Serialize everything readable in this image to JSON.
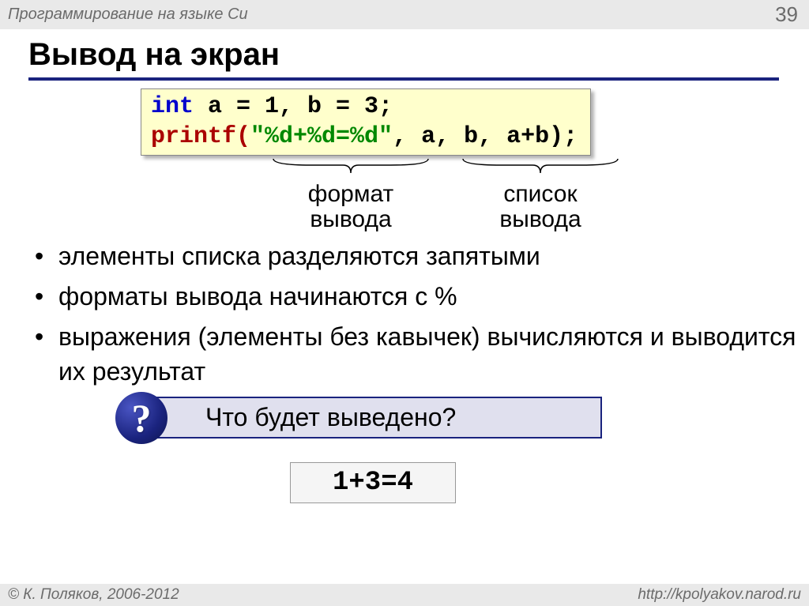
{
  "topbar": {
    "course": "Программирование на языке Си",
    "page": "39"
  },
  "title": "Вывод на экран",
  "code": {
    "line1_kw": "int",
    "line1_rest": " a = 1, b = 3;",
    "line2_fn": "printf(",
    "line2_str": "\"%d+%d=%d\"",
    "line2_rest": ", a, b, a+b);"
  },
  "brace_labels": {
    "format": "формат\nвывода",
    "list": "список\nвывода"
  },
  "bullets": [
    "элементы списка разделяются запятыми",
    "форматы вывода начинаются с %",
    "выражения (элементы без кавычек) вычисляются и выводится их результат"
  ],
  "question": "Что будет выведено?",
  "result": "1+3=4",
  "footer": {
    "copyright": "© К. Поляков, 2006-2012",
    "url": "http://kpolyakov.narod.ru"
  }
}
